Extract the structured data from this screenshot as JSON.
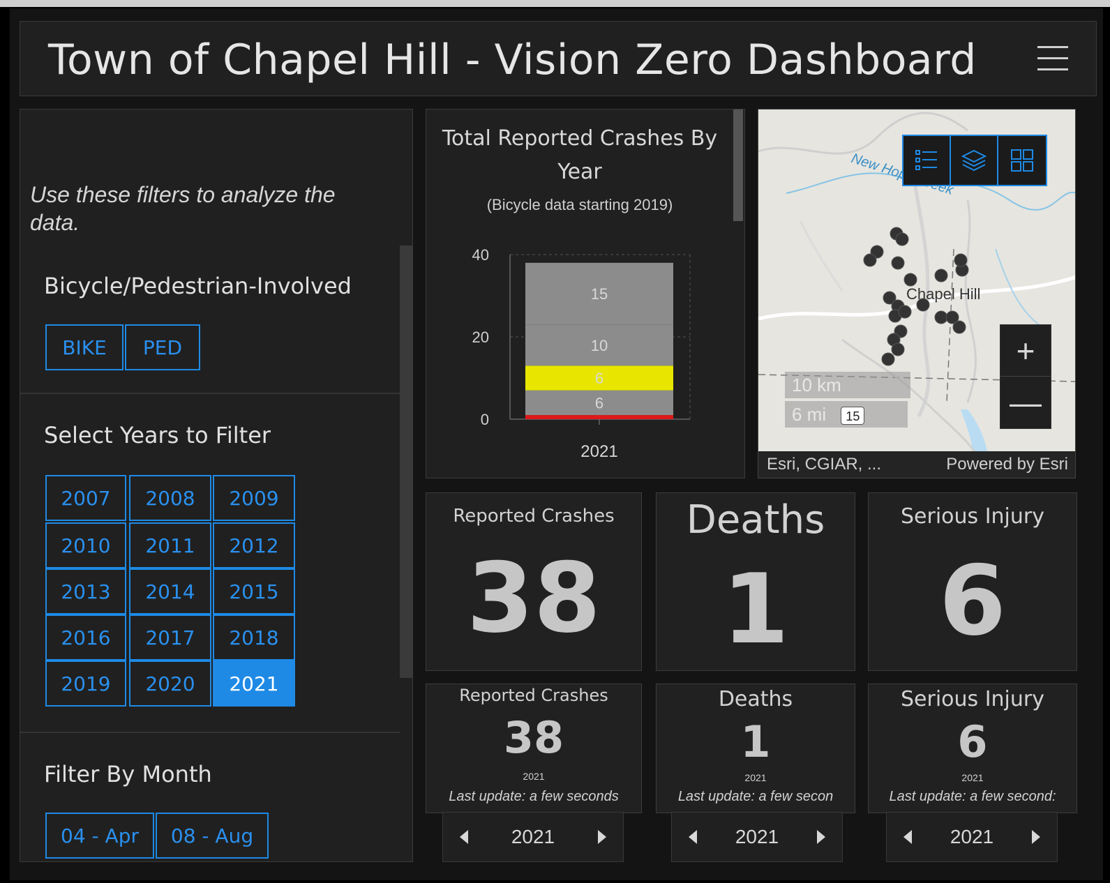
{
  "header": {
    "title": "Town of Chapel Hill - Vision Zero Dashboard"
  },
  "sidebar": {
    "intro": "Use these filters to analyze the data.",
    "bike_ped": {
      "title": "Bicycle/Pedestrian-Involved",
      "options": [
        "BIKE",
        "PED"
      ]
    },
    "years": {
      "title": "Select Years to Filter",
      "options": [
        "2007",
        "2008",
        "2009",
        "2010",
        "2011",
        "2012",
        "2013",
        "2014",
        "2015",
        "2016",
        "2017",
        "2018",
        "2019",
        "2020",
        "2021"
      ],
      "selected": "2021"
    },
    "months": {
      "title": "Filter By Month",
      "options": [
        "04 - Apr",
        "08 - Aug"
      ]
    }
  },
  "chart": {
    "title": "Total Reported Crashes By Year",
    "subtitle": "(Bicycle data starting 2019)"
  },
  "chart_data": {
    "type": "bar",
    "stacked": true,
    "categories": [
      "2021"
    ],
    "series": [
      {
        "values": [
          1
        ],
        "color": "#e0181b"
      },
      {
        "values": [
          6
        ],
        "color": "#8c8c8c",
        "label": "6"
      },
      {
        "values": [
          6
        ],
        "color": "#e8e600",
        "label": "6"
      },
      {
        "values": [
          10
        ],
        "color": "#8c8c8c",
        "label": "10"
      },
      {
        "values": [
          15
        ],
        "color": "#8c8c8c",
        "label": "15"
      }
    ],
    "yticks": [
      0,
      20,
      40
    ],
    "ylim": [
      0,
      40
    ]
  },
  "map": {
    "place_label": "Chapel Hill",
    "creek_label": "New Hope Creek",
    "highway": "15",
    "scale_km": "10 km",
    "scale_mi": "6 mi",
    "attribution_left": "Esri, CGIAR, ...",
    "attribution_right": "Powered by Esri",
    "tools": [
      "legend-icon",
      "layers-icon",
      "basemap-gallery-icon"
    ],
    "zoom_in": "+",
    "zoom_out": "—"
  },
  "indicators_top": [
    {
      "label": "Reported Crashes",
      "value": "38"
    },
    {
      "label": "Deaths",
      "value": "1"
    },
    {
      "label": "Serious Injury",
      "value": "6"
    }
  ],
  "indicators_bottom": [
    {
      "label": "Reported Crashes",
      "value": "38",
      "year": "2021",
      "update": "Last update: a few seconds"
    },
    {
      "label": "Deaths",
      "value": "1",
      "year": "2021",
      "update": "Last update: a few secon"
    },
    {
      "label": "Serious Injury",
      "value": "6",
      "year": "2021",
      "update": "Last update: a few second:"
    }
  ],
  "selectors": [
    "2021",
    "2021",
    "2021"
  ],
  "colors": {
    "accent": "#1e8ae6",
    "background": "#141414",
    "panel": "#222222"
  }
}
